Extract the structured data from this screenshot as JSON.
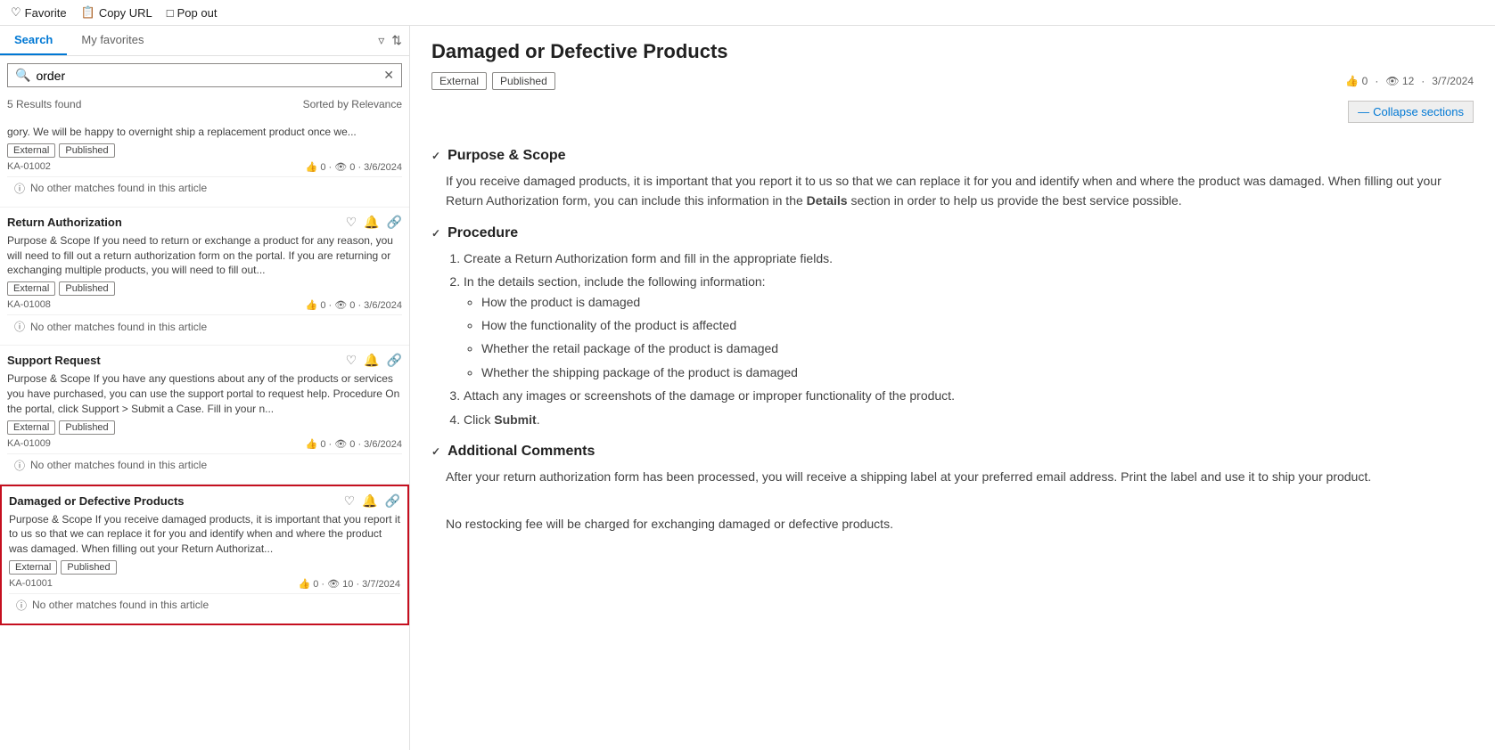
{
  "topbar": {
    "favorite_label": "Favorite",
    "copy_label": "Copy URL",
    "popout_label": "Pop out"
  },
  "tabs": [
    {
      "id": "search",
      "label": "Search",
      "active": true
    },
    {
      "id": "favorites",
      "label": "My favorites",
      "active": false
    }
  ],
  "search": {
    "placeholder": "order",
    "results_count": "5 Results found",
    "sorted_by": "Sorted by Relevance"
  },
  "results": [
    {
      "id": "ka01002",
      "title": null,
      "snippet": "gory. We will be happy to overnight ship a replacement product once we...",
      "tags": [
        "External",
        "Published"
      ],
      "ka_id": "KA-01002",
      "likes": "0",
      "views": "0",
      "date": "3/6/2024",
      "no_match": "No other matches found in this article",
      "selected": false,
      "show_title": false
    },
    {
      "id": "ka01008",
      "title": "Return Authorization",
      "snippet": "Purpose & Scope If you need to return or exchange a product for any reason, you will need to fill out a return authorization form on the portal. If you are returning or exchanging multiple products, you will need to fill out...",
      "tags": [
        "External",
        "Published"
      ],
      "ka_id": "KA-01008",
      "likes": "0",
      "views": "0",
      "date": "3/6/2024",
      "no_match": "No other matches found in this article",
      "selected": false,
      "show_title": true
    },
    {
      "id": "ka01009",
      "title": "Support Request",
      "snippet": "Purpose & Scope If you have any questions about any of the products or services you have purchased, you can use the support portal to request help. Procedure On the portal, click Support > Submit a Case. Fill in your n...",
      "tags": [
        "External",
        "Published"
      ],
      "ka_id": "KA-01009",
      "likes": "0",
      "views": "0",
      "date": "3/6/2024",
      "no_match": "No other matches found in this article",
      "selected": false,
      "show_title": true
    },
    {
      "id": "ka01001",
      "title": "Damaged or Defective Products",
      "snippet": "Purpose & Scope If you receive damaged products, it is important that you report it to us so that we can replace it for you and identify when and where the product was damaged. When filling out your Return Authorizat...",
      "tags": [
        "External",
        "Published"
      ],
      "ka_id": "KA-01001",
      "likes": "0",
      "views": "10",
      "date": "3/7/2024",
      "no_match": "No other matches found in this article",
      "selected": true,
      "show_title": true
    }
  ],
  "article": {
    "title": "Damaged or Defective Products",
    "tags": [
      "External",
      "Published"
    ],
    "likes": "0",
    "views": "12",
    "date": "3/7/2024",
    "collapse_label": "Collapse sections",
    "sections": [
      {
        "id": "purpose",
        "heading": "Purpose & Scope",
        "expanded": true,
        "content_type": "paragraph",
        "text": "If you receive damaged products, it is important that you report it to us so that we can replace it for you and identify when and where the product was damaged. When filling out your Return Authorization form, you can include this information in the Details section in order to help us provide the best service possible."
      },
      {
        "id": "procedure",
        "heading": "Procedure",
        "expanded": true,
        "content_type": "ordered-list",
        "items": [
          {
            "text": "Create a Return Authorization form and fill in the appropriate fields.",
            "sub_items": []
          },
          {
            "text": "In the details section, include the following information:",
            "sub_items": [
              "How the product is damaged",
              "How the functionality of the product is affected",
              "Whether the retail package of the product is damaged",
              "Whether the shipping package of the product is damaged"
            ]
          },
          {
            "text": "Attach any images or screenshots of the damage or improper functionality of the product.",
            "sub_items": []
          },
          {
            "text": "Click Submit.",
            "sub_items": [],
            "bold_word": "Submit"
          }
        ]
      },
      {
        "id": "comments",
        "heading": "Additional Comments",
        "expanded": true,
        "content_type": "paragraphs",
        "paragraphs": [
          "After your return authorization form has been processed, you will receive a shipping label at your preferred email address. Print the label and use it to ship your product.",
          "No restocking fee will be charged for exchanging damaged or defective products."
        ]
      }
    ]
  }
}
